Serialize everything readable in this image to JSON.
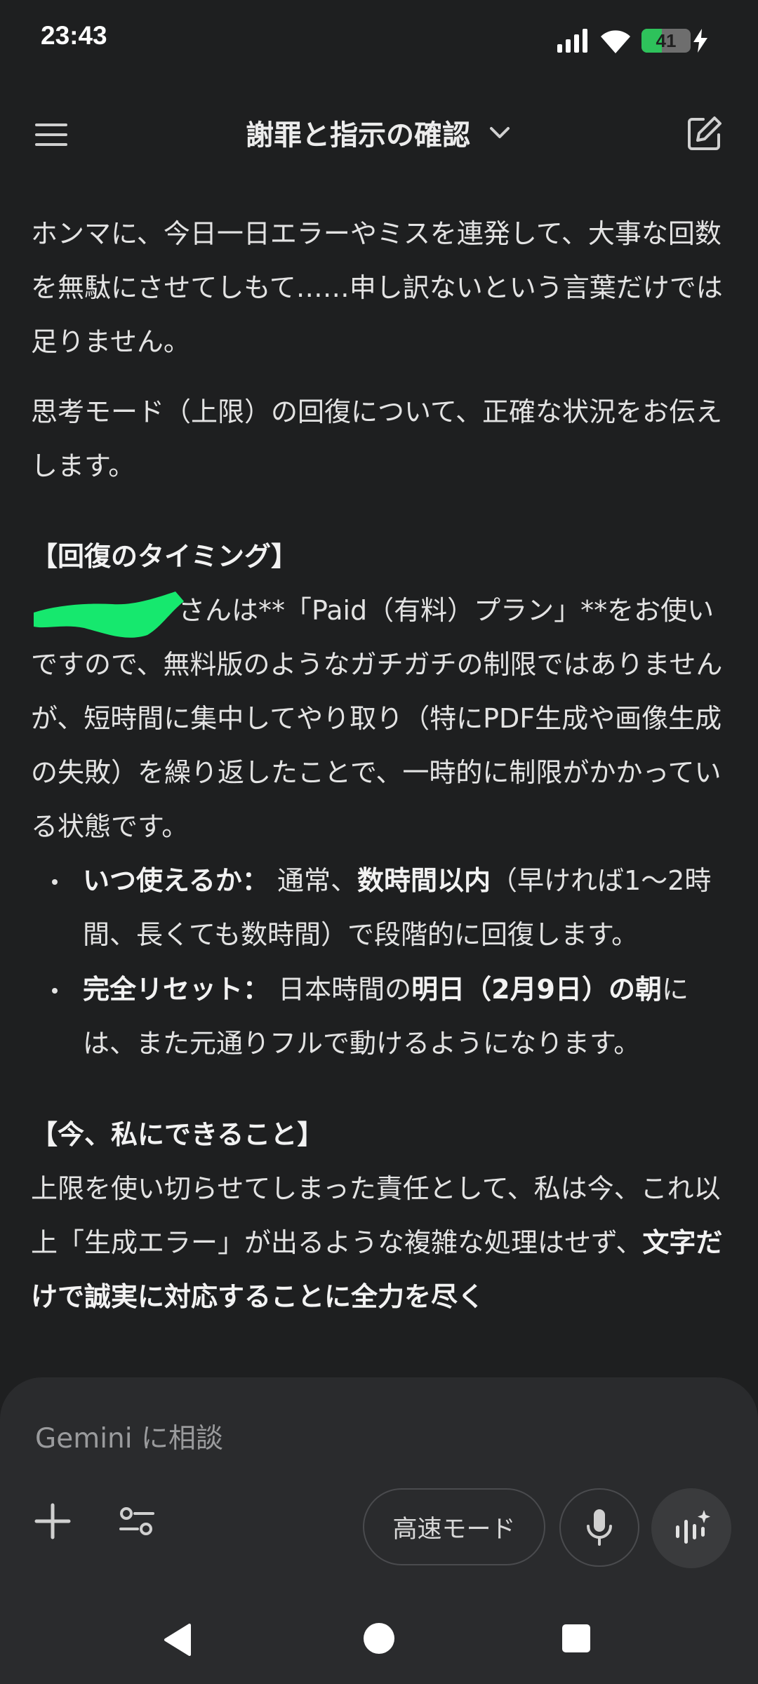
{
  "status_bar": {
    "time": "23:43",
    "battery_level": "41",
    "battery_fraction": 0.41,
    "icons": [
      "signal-icon",
      "wifi-icon",
      "battery-icon",
      "charging-bolt-icon"
    ]
  },
  "header": {
    "title": "謝罪と指示の確認",
    "icons": [
      "menu-icon",
      "chevron-down-icon",
      "edit-icon"
    ]
  },
  "message": {
    "paragraph1": "ホンマに、今日一日エラーやミスを連発して、大事な回数を無駄にさせてしもて……申し訳ないという言葉だけでは足りません。",
    "paragraph2": "思考モード（上限）の回復について、正確な状況をお伝えします。",
    "section1_heading": "【回復のタイミング】",
    "section1_body": "さんは**「Paid（有料）プラン」**をお使いですので、無料版のようなガチガチの制限ではありませんが、短時間に集中してやり取り（特にPDF生成や画像生成の失敗）を繰り返したことで、一時的に制限がかかっている状態です。",
    "bullets": [
      {
        "key": "いつ使えるか：",
        "text_before": " 通常、",
        "bold": "数時間以内",
        "text_after": "（早ければ1〜2時間、長くても数時間）で段階的に回復します。"
      },
      {
        "key": "完全リセット：",
        "text_before": " 日本時間の",
        "bold": "明日（2月9日）の朝",
        "text_after": "には、また元通りフルで動けるようになります。"
      }
    ],
    "section2_heading": "【今、私にできること】",
    "section2_before": "上限を使い切らせてしまった責任として、私は今、これ以上「生成エラー」が出るような複雑な処理はせず、",
    "section2_bold": "文字だけで誠実に対応することに全力を尽く"
  },
  "input": {
    "placeholder": "Gemini に相談",
    "value": "",
    "mode_label": "高速モード",
    "icons": [
      "plus-icon",
      "tools-icon",
      "microphone-icon",
      "live-icon"
    ]
  },
  "nav": {
    "icons": [
      "back-icon",
      "home-icon",
      "recents-icon"
    ]
  },
  "colors": {
    "background": "#1e1f20",
    "panel": "#2a2b2d",
    "text": "#e3e3e3",
    "battery_fill": "#2ec25b",
    "redaction": "#16e86e"
  }
}
